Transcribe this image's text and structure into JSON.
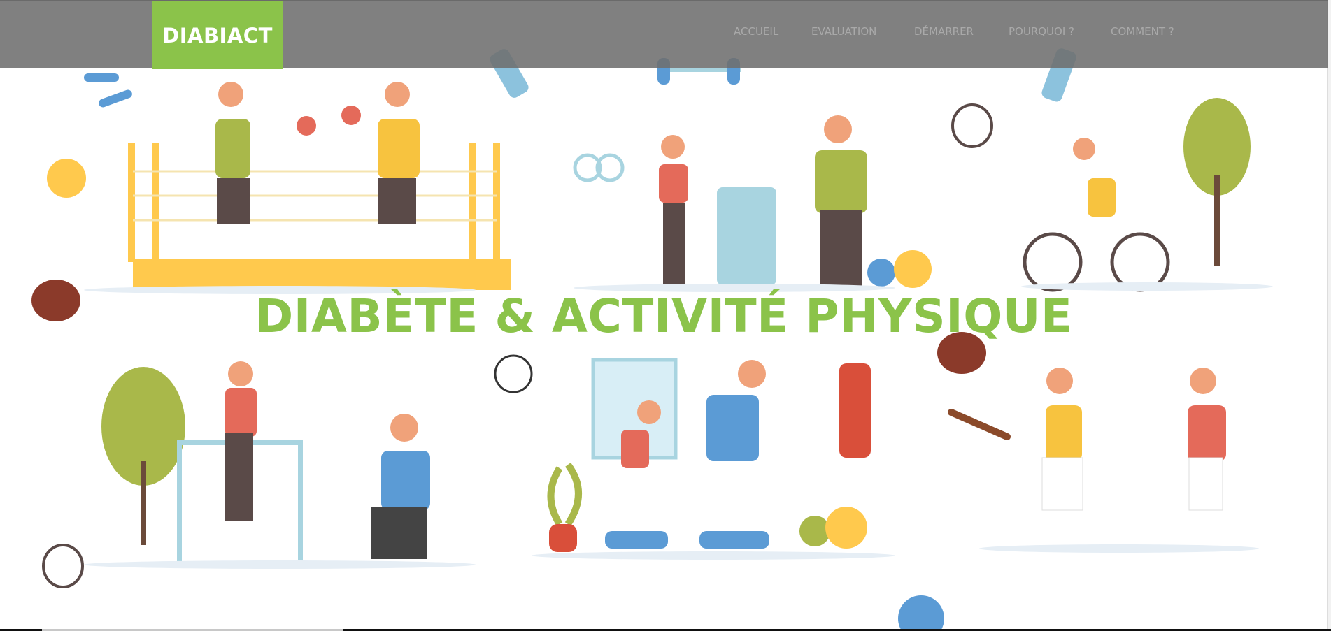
{
  "brand": "DIABIACT",
  "nav": [
    "ACCUEIL",
    "EVALUATION",
    "DÉMARRER",
    "POURQUOI ?",
    "COMMENT ?"
  ],
  "hero": {
    "title": "DIABÈTE & ACTIVITÉ PHYSIQUE"
  },
  "colors": {
    "accent": "#8bc34a",
    "navbar": "#7a7a7a"
  }
}
